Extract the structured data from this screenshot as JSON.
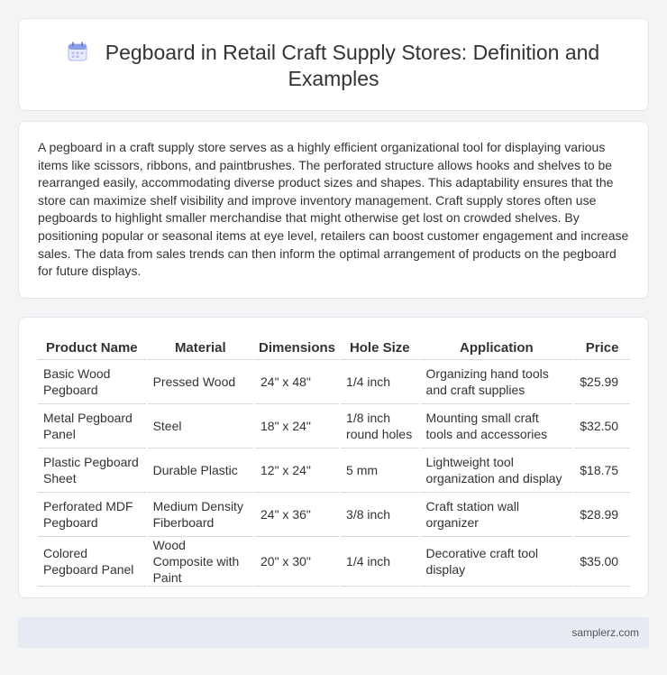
{
  "header": {
    "title": "Pegboard in Retail Craft Supply Stores: Definition and Examples",
    "icon": "calendar-icon"
  },
  "description": "A pegboard in a craft supply store serves as a highly efficient organizational tool for displaying various items like scissors, ribbons, and paintbrushes. The perforated structure allows hooks and shelves to be rearranged easily, accommodating diverse product sizes and shapes. This adaptability ensures that the store can maximize shelf visibility and improve inventory management. Craft supply stores often use pegboards to highlight smaller merchandise that might otherwise get lost on crowded shelves. By positioning popular or seasonal items at eye level, retailers can boost customer engagement and increase sales. The data from sales trends can then inform the optimal arrangement of products on the pegboard for future displays.",
  "table": {
    "headers": [
      "Product Name",
      "Material",
      "Dimensions",
      "Hole Size",
      "Application",
      "Price"
    ],
    "rows": [
      [
        "Basic Wood Pegboard",
        "Pressed Wood",
        "24\" x 48\"",
        "1/4 inch",
        "Organizing hand tools and craft supplies",
        "$25.99"
      ],
      [
        "Metal Pegboard Panel",
        "Steel",
        "18\" x 24\"",
        "1/8 inch round holes",
        "Mounting small craft tools and accessories",
        "$32.50"
      ],
      [
        "Plastic Pegboard Sheet",
        "Durable Plastic",
        "12\" x 24\"",
        "5 mm",
        "Lightweight tool organization and display",
        "$18.75"
      ],
      [
        "Perforated MDF Pegboard",
        "Medium Density Fiberboard",
        "24\" x 36\"",
        "3/8 inch",
        "Craft station wall organizer",
        "$28.99"
      ],
      [
        "Colored Pegboard Panel",
        "Wood Composite with Paint",
        "20\" x 30\"",
        "1/4 inch",
        "Decorative craft tool display",
        "$35.00"
      ]
    ]
  },
  "footer": {
    "site": "samplerz.com"
  },
  "colors": {
    "background": "#f3f4f6",
    "card": "#ffffff",
    "footer": "#e6ebf4",
    "icon_accent": "#7b8ee0"
  }
}
